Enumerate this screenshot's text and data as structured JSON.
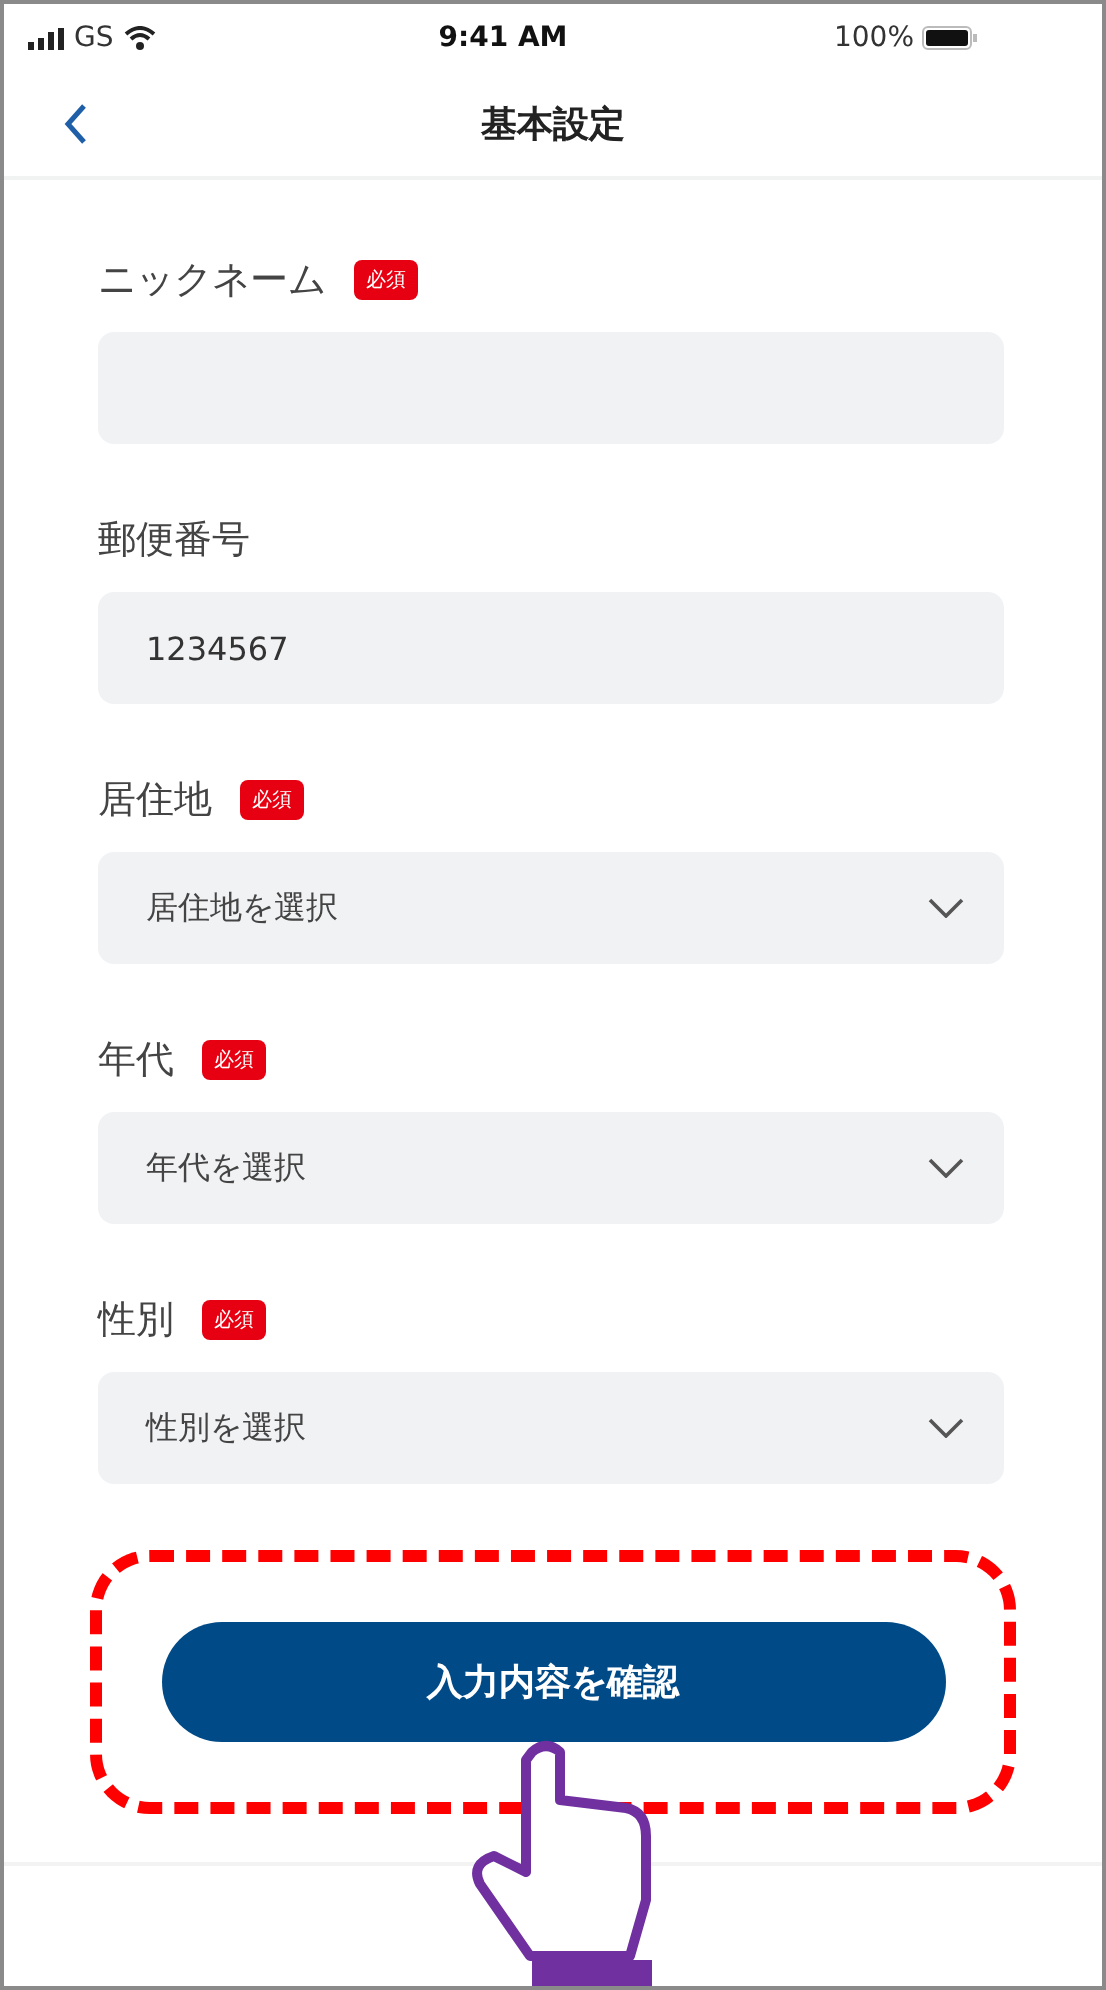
{
  "status_bar": {
    "carrier": "GS",
    "time": "9:41 AM",
    "battery": "100%"
  },
  "nav": {
    "title": "基本設定"
  },
  "fields": [
    {
      "kind": "text",
      "label": "ニックネーム",
      "required": true,
      "badge": "必須"
    },
    {
      "kind": "text",
      "label": "郵便番号",
      "required": false,
      "value": "1234567"
    },
    {
      "kind": "select",
      "label": "居住地",
      "required": true,
      "badge": "必須",
      "placeholder": "居住地を選択"
    },
    {
      "kind": "select",
      "label": "年代",
      "required": true,
      "badge": "必須",
      "placeholder": "年代を選択"
    },
    {
      "kind": "select",
      "label": "性別",
      "required": true,
      "badge": "必須",
      "placeholder": "性別を選択"
    }
  ],
  "confirm_button": {
    "label": "入力内容を確認"
  }
}
